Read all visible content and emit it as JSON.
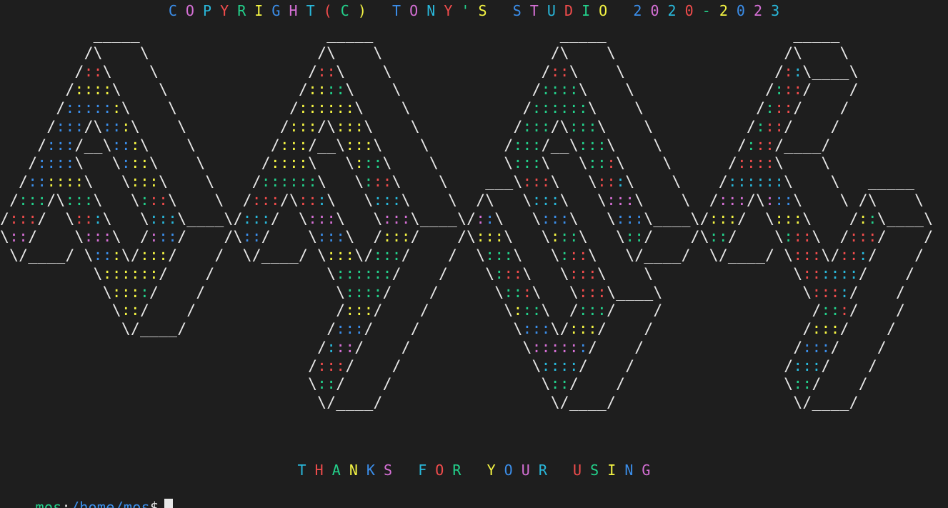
{
  "terminal": {
    "background": "#1e1e1e",
    "foreground": "#e8e8e8",
    "palette": [
      "#f14c4c",
      "#23d18b",
      "#f5f543",
      "#3b8eea",
      "#d670d6",
      "#29b8db"
    ]
  },
  "banner": {
    "copyright": "COPYRIGHT(C) TONY'S STUDIO 2020-2023",
    "thanks": "THANKS FOR YOUR USING"
  },
  "logo": {
    "word": "MSOS",
    "lines": [
      "          _____                    _____                    _____                    _____",
      "         /\\    \\                  /\\    \\                  /\\    \\                  /\\    \\",
      "        /::\\    \\                /::\\    \\                /::\\    \\                /::\\____\\",
      "       /::::\\    \\              /::::\\    \\              /::::\\    \\              /:::/    /",
      "      /::::::\\    \\            /::::::\\    \\            /::::::\\    \\            /:::/    /",
      "     /:::/\\:::\\    \\          /:::/\\:::\\    \\          /:::/\\:::\\    \\          /:::/    /",
      "    /:::/__\\:::\\    \\        /:::/__\\:::\\    \\        /:::/__\\:::\\    \\        /:::/____/",
      "   /::::\\   \\:::\\    \\      /::::\\   \\:::\\    \\       \\:::\\   \\:::\\    \\      /::::\\    \\",
      "  /::::::\\   \\:::\\    \\    /::::::\\   \\:::\\    \\    ___\\:::\\   \\:::\\    \\    /::::::\\    \\   _____",
      " /:::/\\:::\\   \\:::\\    \\  /:::/\\:::\\   \\:::\\    \\  /\\   \\:::\\   \\:::\\    \\  /:::/\\:::\\    \\ /\\    \\",
      "/:::/  \\:::\\   \\:::\\____\\/:::/  \\:::\\   \\:::\\____\\/::\\   \\:::\\   \\:::\\____\\/:::/  \\:::\\    /::\\____\\",
      "\\::/    \\:::\\  /:::/    /\\::/    \\:::\\  /:::/    /\\:::\\   \\:::\\   \\::/    /\\::/    \\:::\\  /:::/    /",
      " \\/____/ \\:::\\/:::/    /  \\/____/ \\:::\\/:::/    /  \\:::\\   \\:::\\   \\/____/  \\/____/ \\:::\\/:::/    /",
      "          \\::::::/    /            \\::::::/    /    \\:::\\   \\:::\\    \\               \\::::::/    /",
      "           \\::::/    /              \\::::/    /      \\:::\\   \\:::\\____\\               \\::::/    /",
      "            \\::/    /               /:::/    /        \\:::\\  /:::/    /                /:::/    /",
      "             \\/____/               /:::/    /          \\:::\\/:::/    /                /:::/    /",
      "                                  /:::/    /            \\::::::/    /                /:::/    /",
      "                                 /:::/    /              \\::::/    /                /:::/    /",
      "                                 \\::/    /                \\::/    /                 \\::/    /",
      "                                  \\/____/                  \\/____/                   \\/____/"
    ]
  },
  "prompt": {
    "user": "mos",
    "separator": ":",
    "path": "/home/mos",
    "symbol": "$"
  }
}
